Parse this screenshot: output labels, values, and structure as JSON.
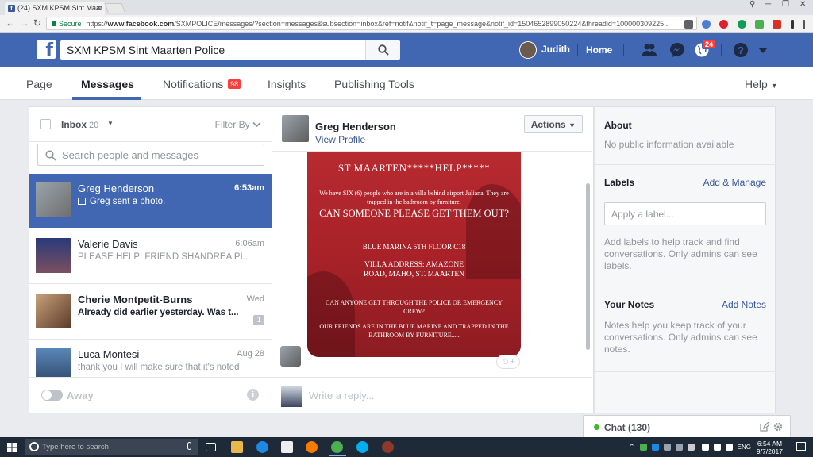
{
  "browser": {
    "tab_title": "(24) SXM KPSM Sint Maar",
    "secure_label": "Secure",
    "url_prefix": "https://",
    "url_host": "www.facebook.com",
    "url_path": "/SXMPOLICE/messages/?section=messages&subsection=inbox&ref=notif&notif_t=page_message&notif_id=1504652899050224&threadid=100000309225..."
  },
  "fb": {
    "search_value": "SXM KPSM Sint Maarten Police",
    "user_name": "Judith",
    "home_label": "Home",
    "notif_count": "24"
  },
  "page_nav": {
    "page": "Page",
    "messages": "Messages",
    "notifications": "Notifications",
    "notifications_badge": "98",
    "insights": "Insights",
    "publishing_tools": "Publishing Tools",
    "help": "Help"
  },
  "inbox": {
    "label": "Inbox",
    "count": "20",
    "filter_label": "Filter By",
    "search_placeholder": "Search people and messages",
    "conversations": [
      {
        "name": "Greg Henderson",
        "time": "6:53am",
        "preview": "Greg sent a photo."
      },
      {
        "name": "Valerie Davis",
        "time": "6:06am",
        "preview": "PLEASE HELP! FRIEND SHANDREA PI..."
      },
      {
        "name": "Cherie Montpetit-Burns",
        "time": "Wed",
        "preview": "Already did earlier yesterday. Was t...",
        "unread_count": "1"
      },
      {
        "name": "Luca Montesi",
        "time": "Aug 28",
        "preview": "thank you I will make sure that it's noted"
      }
    ],
    "away_label": "Away"
  },
  "thread": {
    "name": "Greg Henderson",
    "view_profile": "View Profile",
    "actions_label": "Actions",
    "reply_placeholder": "Write a reply...",
    "photo": {
      "title": "ST MAARTEN*****HELP*****",
      "line1": "We have SIX (6) people who are in a villa behind airport Juliana. They are trapped in the bathroom by furniture.",
      "big1": "CAN SOMEONE PLEASE GET THEM OUT?",
      "loc": "BLUE MARINA 5TH FLOOR C18",
      "addr": "VILLA ADDRESS: AMAZONE ROAD, MAHO, ST. MAARTEN",
      "line2": "CAN ANYONE GET THROUGH THE POLICE OR EMERGENCY CREW?",
      "line3": "OUR FRIENDS ARE IN THE BLUE MARINE AND TRAPPED IN THE BATHROOM BY FURNITURE....."
    }
  },
  "sidebar": {
    "about_title": "About",
    "about_text": "No public information available",
    "labels_title": "Labels",
    "labels_link": "Add & Manage",
    "labels_placeholder": "Apply a label...",
    "labels_help": "Add labels to help track and find conversations. Only admins can see labels.",
    "notes_title": "Your Notes",
    "notes_link": "Add Notes",
    "notes_help": "Notes help you keep track of your conversations. Only admins can see notes."
  },
  "chat": {
    "label": "Chat (130)"
  },
  "taskbar": {
    "search_placeholder": "Type here to search",
    "lang": "ENG",
    "time": "6:54 AM",
    "date": "9/7/2017"
  },
  "colors": {
    "fb_blue": "#4267b2",
    "badge_red": "#fa3e3e",
    "link": "#365899"
  }
}
